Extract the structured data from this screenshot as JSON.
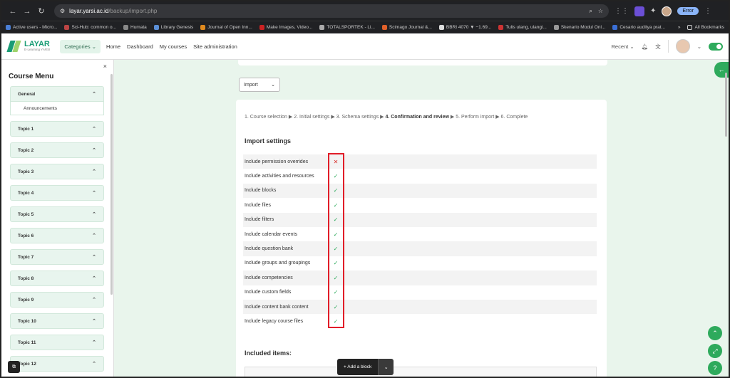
{
  "browser": {
    "url_host": "layar.yarsi.ac.id",
    "url_path": "/backup/import.php",
    "profile_button": "Error",
    "bookmarks": [
      {
        "label": "Active users - Micro...",
        "color": "#4a7fd6"
      },
      {
        "label": "Sci-Hub: common o...",
        "color": "#b44"
      },
      {
        "label": "Humata",
        "color": "#888"
      },
      {
        "label": "Library Genesis",
        "color": "#5b8fd6"
      },
      {
        "label": "Journal of Open Inn...",
        "color": "#e08a1e"
      },
      {
        "label": "Make Images, Video...",
        "color": "#c22"
      },
      {
        "label": "TOTALSPORTEK - Li...",
        "color": "#aaa"
      },
      {
        "label": "Scimago Journal &...",
        "color": "#e0602a"
      },
      {
        "label": "BBRI 4070 ▼ −1.69...",
        "color": "#ddd"
      },
      {
        "label": "Tulis ulang, ulangi...",
        "color": "#c33"
      },
      {
        "label": "Skenario Modul Onl...",
        "color": "#999"
      },
      {
        "label": "Cesario auditya prat...",
        "color": "#3a6fd6"
      }
    ],
    "all_bookmarks": "All Bookmarks"
  },
  "header": {
    "logo_title": "LAYAR",
    "logo_subtitle": "E-Learning YARSI",
    "categories": "Categories",
    "nav": [
      "Home",
      "Dashboard",
      "My courses",
      "Site administration"
    ],
    "recent": "Recent"
  },
  "drawer": {
    "close": "×",
    "title": "Course Menu",
    "general": "General",
    "activity": "Announcements",
    "topics": [
      "Topic 1",
      "Topic 2",
      "Topic 3",
      "Topic 4",
      "Topic 5",
      "Topic 6",
      "Topic 7",
      "Topic 8",
      "Topic 9",
      "Topic 10",
      "Topic 11",
      "Topic 12"
    ]
  },
  "main": {
    "import_select": "Import",
    "steps": {
      "before": "1. Course selection ▶ 2. Initial settings ▶ 3. Schema settings ▶ ",
      "current": "4. Confirmation and review",
      "after": " ▶ 5. Perform import ▶ 6. Complete"
    },
    "settings_heading": "Import settings",
    "settings": [
      {
        "label": "Include permission overrides",
        "enabled": false,
        "mark": "✕"
      },
      {
        "label": "Include activities and resources",
        "enabled": true,
        "mark": "✓"
      },
      {
        "label": "Include blocks",
        "enabled": true,
        "mark": "✓"
      },
      {
        "label": "Include files",
        "enabled": true,
        "mark": "✓"
      },
      {
        "label": "Include filters",
        "enabled": true,
        "mark": "✓"
      },
      {
        "label": "Include calendar events",
        "enabled": true,
        "mark": "✓"
      },
      {
        "label": "Include question bank",
        "enabled": true,
        "mark": "✓"
      },
      {
        "label": "Include groups and groupings",
        "enabled": true,
        "mark": "✓"
      },
      {
        "label": "Include competencies",
        "enabled": true,
        "mark": "✓"
      },
      {
        "label": "Include custom fields",
        "enabled": true,
        "mark": "✓"
      },
      {
        "label": "Include content bank content",
        "enabled": true,
        "mark": "✓"
      },
      {
        "label": "Include legacy course files",
        "enabled": true,
        "mark": "✓"
      }
    ],
    "included_heading": "Included items:"
  },
  "footer": {
    "add_block": "+ Add a block"
  },
  "colors": {
    "accent": "#2eaa5c",
    "highlight": "#e11d28",
    "background": "#e9f5ec"
  }
}
